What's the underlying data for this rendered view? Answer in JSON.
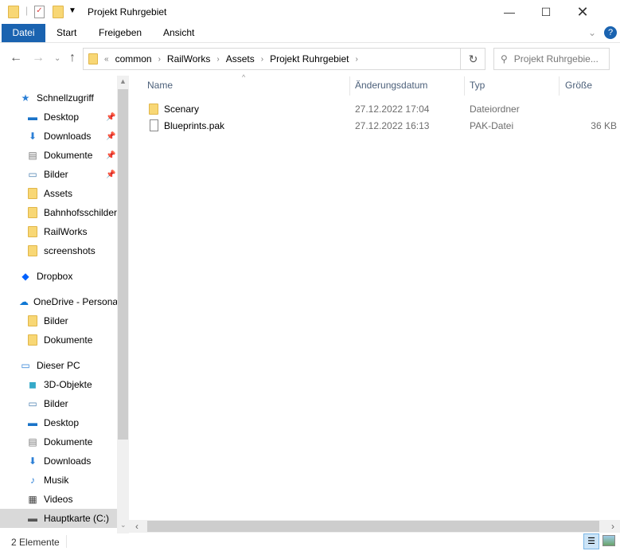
{
  "window": {
    "title": "Projekt Ruhrgebiet"
  },
  "ribbon": {
    "tabs": [
      "Datei",
      "Start",
      "Freigeben",
      "Ansicht"
    ]
  },
  "address": {
    "overflow": "«",
    "crumbs": [
      "common",
      "RailWorks",
      "Assets",
      "Projekt Ruhrgebiet"
    ]
  },
  "search": {
    "placeholder": "Projekt Ruhrgebie..."
  },
  "sidebar": {
    "items": [
      {
        "label": "Schnellzugriff",
        "icon": "star-icon"
      },
      {
        "label": "Desktop",
        "icon": "desktop-icon",
        "pinned": true
      },
      {
        "label": "Downloads",
        "icon": "download-icon",
        "pinned": true
      },
      {
        "label": "Dokumente",
        "icon": "document-icon",
        "pinned": true
      },
      {
        "label": "Bilder",
        "icon": "pictures-icon",
        "pinned": true
      },
      {
        "label": "Assets",
        "icon": "folder-icon"
      },
      {
        "label": "Bahnhofsschilder",
        "icon": "folder-icon"
      },
      {
        "label": "RailWorks",
        "icon": "folder-icon"
      },
      {
        "label": "screenshots",
        "icon": "folder-icon"
      },
      {
        "label": "Dropbox",
        "icon": "dropbox-icon"
      },
      {
        "label": "OneDrive - Persona",
        "icon": "cloud-icon"
      },
      {
        "label": "Bilder",
        "icon": "folder-icon"
      },
      {
        "label": "Dokumente",
        "icon": "folder-icon"
      },
      {
        "label": "Dieser PC",
        "icon": "pc-icon"
      },
      {
        "label": "3D-Objekte",
        "icon": "cube-icon"
      },
      {
        "label": "Bilder",
        "icon": "pictures-icon"
      },
      {
        "label": "Desktop",
        "icon": "desktop-icon"
      },
      {
        "label": "Dokumente",
        "icon": "document-icon"
      },
      {
        "label": "Downloads",
        "icon": "download-icon"
      },
      {
        "label": "Musik",
        "icon": "music-icon"
      },
      {
        "label": "Videos",
        "icon": "video-icon"
      },
      {
        "label": "Hauptkarte (C:)",
        "icon": "drive-icon",
        "selected": true
      }
    ]
  },
  "columns": [
    "Name",
    "Änderungsdatum",
    "Typ",
    "Größe"
  ],
  "files": [
    {
      "name": "Scenary",
      "date": "27.12.2022 17:04",
      "type": "Dateiordner",
      "size": "",
      "icon": "folder-icon"
    },
    {
      "name": "Blueprints.pak",
      "date": "27.12.2022 16:13",
      "type": "PAK-Datei",
      "size": "36 KB",
      "icon": "file-icon"
    }
  ],
  "status": {
    "count": "2 Elemente"
  }
}
